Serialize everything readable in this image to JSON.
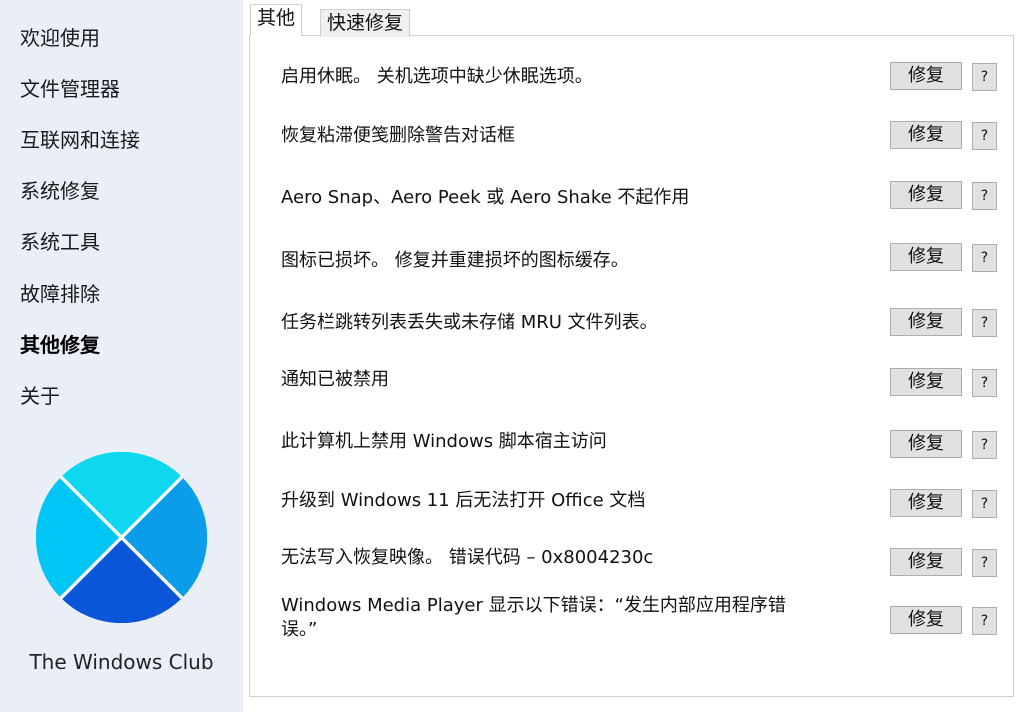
{
  "sidebar": {
    "items": [
      {
        "label": "欢迎使用",
        "active": false
      },
      {
        "label": "文件管理器",
        "active": false
      },
      {
        "label": "互联网和连接",
        "active": false
      },
      {
        "label": "系统修复",
        "active": false
      },
      {
        "label": "系统工具",
        "active": false
      },
      {
        "label": "故障排除",
        "active": false
      },
      {
        "label": "其他修复",
        "active": true
      },
      {
        "label": "关于",
        "active": false
      }
    ],
    "brand": "The Windows Club",
    "logo_icon": "windows-club-logo-icon"
  },
  "tabs": [
    {
      "label": "其他",
      "active": true
    },
    {
      "label": "快速修复",
      "active": false
    }
  ],
  "fixes": [
    {
      "text": "启用休眠。 关机选项中缺少休眠选项。",
      "button": "修复",
      "help": "?"
    },
    {
      "text": "恢复粘滞便笺删除警告对话框",
      "button": "修复",
      "help": "?"
    },
    {
      "text": "Aero Snap、Aero Peek 或 Aero Shake 不起作用",
      "button": "修复",
      "help": "?"
    },
    {
      "text": "图标已损坏。 修复并重建损坏的图标缓存。",
      "button": "修复",
      "help": "?"
    },
    {
      "text": "任务栏跳转列表丢失或未存储 MRU 文件列表。",
      "button": "修复",
      "help": "?"
    },
    {
      "text": "通知已被禁用",
      "button": "修复",
      "help": "?"
    },
    {
      "text": "此计算机上禁用 Windows 脚本宿主访问",
      "button": "修复",
      "help": "?"
    },
    {
      "text": "升级到 Windows 11 后无法打开 Office 文档",
      "button": "修复",
      "help": "?"
    },
    {
      "text": "无法写入恢复映像。 错误代码 – 0x8004230c",
      "button": "修复",
      "help": "?"
    },
    {
      "text": "Windows Media Player 显示以下错误：“发生内部应用程序错误。”",
      "button": "修复",
      "help": "?"
    }
  ],
  "colors": {
    "sidebar_bg": "#e9eef7",
    "logo_top": "#0ed8f0",
    "logo_left": "#00c6f5",
    "logo_right": "#0b9cea",
    "logo_bottom": "#0a56d8",
    "button_bg": "#e1e1e1"
  }
}
